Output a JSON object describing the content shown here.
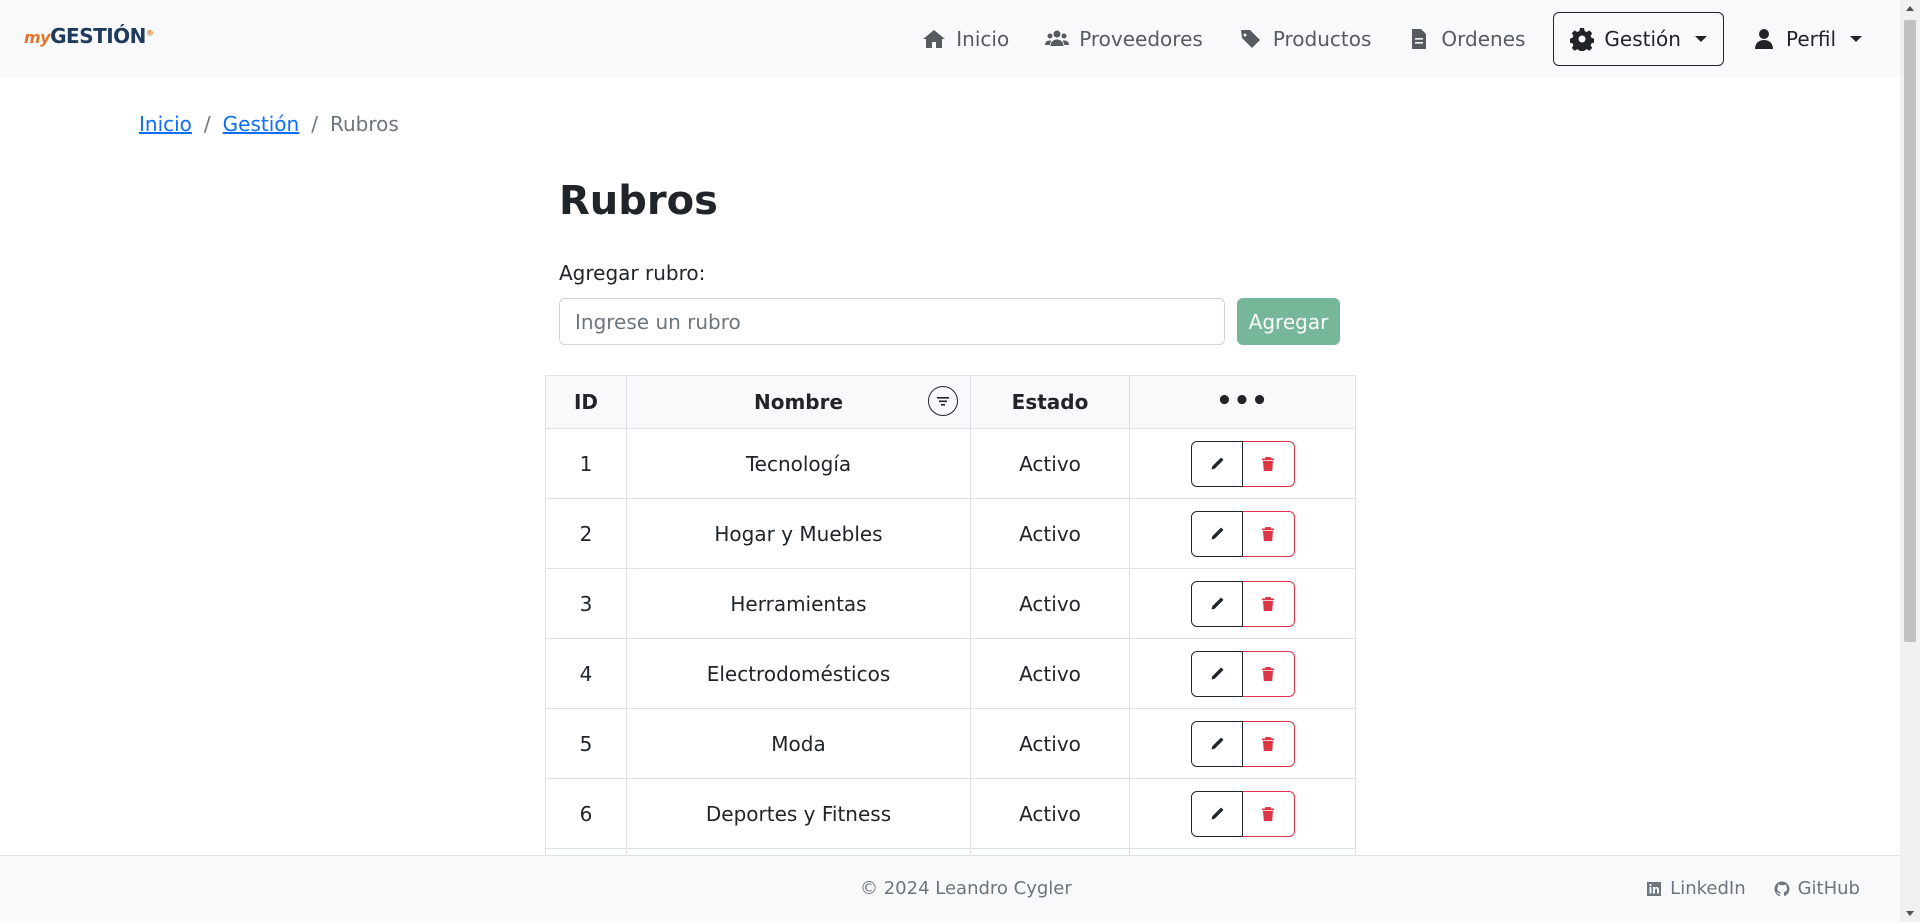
{
  "brand": {
    "prefix": "my",
    "name": "GESTIÓN",
    "mark": "®"
  },
  "nav": {
    "items": [
      {
        "label": "Inicio",
        "icon": "home-icon"
      },
      {
        "label": "Proveedores",
        "icon": "users-icon"
      },
      {
        "label": "Productos",
        "icon": "tags-icon"
      },
      {
        "label": "Ordenes",
        "icon": "file-icon"
      }
    ],
    "gestion": {
      "label": "Gestión",
      "icon": "gear-icon"
    },
    "profile": {
      "label": "Perfil",
      "icon": "user-icon"
    }
  },
  "breadcrumb": {
    "home": "Inicio",
    "section": "Gestión",
    "current": "Rubros",
    "separator": "/"
  },
  "page": {
    "title": "Rubros"
  },
  "form": {
    "label": "Agregar rubro:",
    "placeholder": "Ingrese un rubro",
    "value": "",
    "button": "Agregar"
  },
  "table": {
    "headers": {
      "id": "ID",
      "name": "Nombre",
      "state": "Estado",
      "actions": "•••"
    },
    "rows": [
      {
        "id": "1",
        "name": "Tecnología",
        "state": "Activo"
      },
      {
        "id": "2",
        "name": "Hogar y Muebles",
        "state": "Activo"
      },
      {
        "id": "3",
        "name": "Herramientas",
        "state": "Activo"
      },
      {
        "id": "4",
        "name": "Electrodomésticos",
        "state": "Activo"
      },
      {
        "id": "5",
        "name": "Moda",
        "state": "Activo"
      },
      {
        "id": "6",
        "name": "Deportes y Fitness",
        "state": "Activo"
      },
      {
        "id": "",
        "name": "",
        "state": ""
      }
    ]
  },
  "footer": {
    "copyright": "© 2024 Leandro Cygler",
    "links": [
      {
        "label": "LinkedIn",
        "icon": "linkedin-icon"
      },
      {
        "label": "GitHub",
        "icon": "github-icon"
      }
    ]
  },
  "colors": {
    "accent": "#0d6efd",
    "success": "#75b798",
    "danger": "#dc3545",
    "brand_orange": "#e8742a",
    "brand_navy": "#1f3a5c"
  }
}
